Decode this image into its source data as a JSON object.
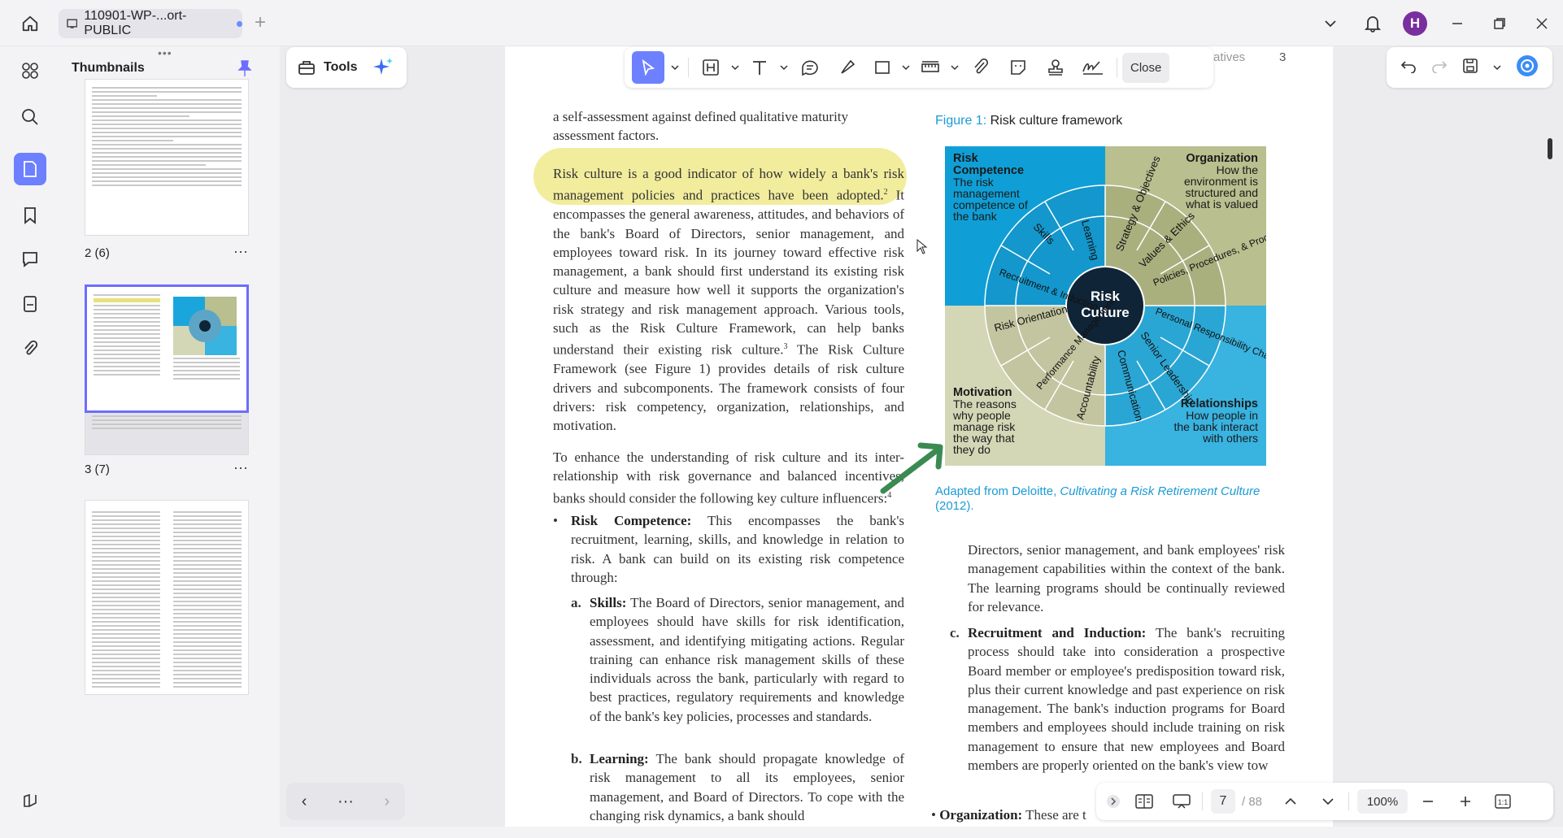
{
  "titlebar": {
    "tab_title": "110901-WP-...ort-PUBLIC",
    "avatar_initial": "H"
  },
  "thumbnails": {
    "panel_title": "Thumbnails",
    "pages": [
      {
        "label": "2 (6)",
        "selected": false
      },
      {
        "label": "3 (7)",
        "selected": true
      },
      {
        "label": "",
        "selected": false
      }
    ],
    "more": "···"
  },
  "tools": {
    "label": "Tools"
  },
  "toolbar": {
    "close_label": "Close",
    "icons": [
      "select-icon",
      "text-box-icon",
      "text-icon",
      "comment-icon",
      "highlighter-icon",
      "shape-icon",
      "measure-icon",
      "attach-icon",
      "sticker-icon",
      "stamp-icon",
      "signature-icon"
    ]
  },
  "header_ghost": "atives",
  "header_page_num": "3",
  "document": {
    "col1_top": "a self-assessment against defined qualitative maturity assessment factors.",
    "highlighted": "Risk culture is a good indicator of how widely a bank's risk management policies and practices have been adopted.",
    "p1_rest": "It encompasses the general awareness, attitudes, and behaviors of the bank's Board of Directors, senior management, and employees toward risk. In its journey toward effective risk management, a bank should first understand its existing risk culture and measure how well it supports the organization's risk strategy and risk management approach. Various tools, such as the Risk Culture Framework, can help banks understand their existing risk culture.",
    "p1_rest2": "The Risk Culture Framework (see Figure 1) provides details of risk culture drivers and subcomponents. The framework consists of four drivers: risk competency, organization, relationships, and motivation.",
    "p2": "To enhance the understanding of risk culture and its inter-relationship with risk governance and balanced incentives, banks should consider the following key culture influencers:",
    "bullet1_head": "Risk Competence:",
    "bullet1_text": "This encompasses the bank's recruitment, learning, skills, and knowledge in relation to risk. A bank can build on its existing risk competence through:",
    "a_head": "Skills:",
    "a_text": "The Board of Directors, senior management, and employees should have skills for risk identification, assessment, and identifying mitigating actions. Regular training can enhance risk management skills of these individuals across the bank, particularly with regard to best practices, regulatory requirements and knowledge of the bank's key policies, processes and standards.",
    "b_head": "Learning:",
    "b_text": "The bank should propagate knowledge of risk management to all its employees, senior management, and Board of Directors. To cope with the changing risk dynamics, a bank should",
    "col2_p": "Directors, senior management, and bank employees' risk management capabilities within the context of the bank. The learning programs should be continually reviewed for relevance.",
    "c_head": "Recruitment and Induction:",
    "c_text": "The bank's recruiting process should take into consideration a prospective Board member or employee's predisposition toward risk, plus their current knowledge and past experience on risk management. The bank's induction programs for Board members and employees should include training on risk management to ensure that new employees and Board members are properly oriented on the bank's view tow",
    "org_head": "Organization:",
    "org_text": "These are t",
    "fn2": "2",
    "fn3": "3",
    "fn4": "4"
  },
  "figure": {
    "caption_prefix": "Figure 1:",
    "caption": "Risk culture framework",
    "center": [
      "Risk",
      "Culture"
    ],
    "quadrants": {
      "tl_title": "Risk Competence",
      "tl_text": "The risk management competence of the bank",
      "tr_title": "Organization",
      "tr_text": "How the environment is structured and what is valued",
      "bl_title": "Motivation",
      "bl_text": "The reasons why people manage risk the way that they do",
      "br_title": "Relationships",
      "br_text": "How people in the bank interact with others"
    },
    "segments": [
      "Learning",
      "Strategy & Objectives",
      "Values & Ethics",
      "Policies, Procedures, & Processes",
      "Personal Responsibility Challenge",
      "Senior Leadership",
      "Communication",
      "Accountability",
      "Performance Management",
      "Risk Orientation",
      "Recruitment & Induction",
      "Skills"
    ],
    "colors": {
      "blue_dark": "#0f9fd6",
      "olive": "#b9bf8e",
      "blue_light": "#39b3e0",
      "beige": "#d4d7b6",
      "center": "#0f2436"
    },
    "source_prefix": "Adapted from Deloitte,",
    "source_title": "Cultivating a Risk Retirement Culture",
    "source_year": "(2012)."
  },
  "bottom": {
    "current_page": "7",
    "total_pages": "/ 88",
    "zoom": "100%"
  }
}
